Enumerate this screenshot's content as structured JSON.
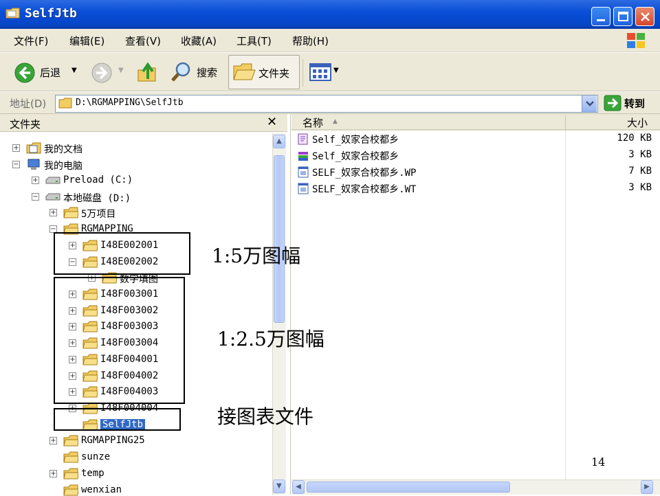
{
  "window": {
    "title": "SelfJtb"
  },
  "menu": [
    "文件(F)",
    "编辑(E)",
    "查看(V)",
    "收藏(A)",
    "工具(T)",
    "帮助(H)"
  ],
  "toolbar": {
    "back_label": "后退",
    "search_label": "搜索",
    "folders_label": "文件夹"
  },
  "address": {
    "label": "地址(D)",
    "value": "D:\\RGMAPPING\\SelfJtb",
    "go_label": "转到"
  },
  "folder_pane": {
    "title": "文件夹",
    "tree": [
      {
        "label": "我的文档",
        "expander": "+"
      },
      {
        "label": "我的电脑",
        "expander": "−"
      },
      {
        "label": "Preload (C:)",
        "expander": "+"
      },
      {
        "label": "本地磁盘 (D:)",
        "expander": "−"
      },
      {
        "label": "5万项目",
        "expander": "+"
      },
      {
        "label": "RGMAPPING",
        "expander": "−"
      },
      {
        "label": "I48E002001",
        "expander": "+"
      },
      {
        "label": "I48E002002",
        "expander": "−"
      },
      {
        "label": "数字填图",
        "expander": "+"
      },
      {
        "label": "I48F003001",
        "expander": "+"
      },
      {
        "label": "I48F003002",
        "expander": "+"
      },
      {
        "label": "I48F003003",
        "expander": "+"
      },
      {
        "label": "I48F003004",
        "expander": "+"
      },
      {
        "label": "I48F004001",
        "expander": "+"
      },
      {
        "label": "I48F004002",
        "expander": "+"
      },
      {
        "label": "I48F004003",
        "expander": "+"
      },
      {
        "label": "I48F004004",
        "expander": "+"
      },
      {
        "label": "SelfJtb",
        "expander": ""
      },
      {
        "label": "RGMAPPING25",
        "expander": "+"
      },
      {
        "label": "sunze",
        "expander": ""
      },
      {
        "label": "temp",
        "expander": "+"
      },
      {
        "label": "wenxian",
        "expander": ""
      }
    ]
  },
  "file_list": {
    "columns": {
      "name": "名称",
      "size": "大小"
    },
    "files": [
      {
        "name": "Self_奴家合校都乡",
        "size": "120 KB"
      },
      {
        "name": "Self_奴家合校都乡",
        "size": "3 KB"
      },
      {
        "name": "SELF_奴家合校都乡.WP",
        "size": "7 KB"
      },
      {
        "name": "SELF_奴家合校都乡.WT",
        "size": "3 KB"
      }
    ]
  },
  "annotations": {
    "sheet_50k": "1:5万图幅",
    "sheet_25k": "1:2.5万图幅",
    "index_files": "接图表文件"
  },
  "page_number": "14",
  "colors": {
    "titlebar": "#0a4fd8",
    "selection": "#316ac5",
    "chrome": "#ece9d8"
  }
}
